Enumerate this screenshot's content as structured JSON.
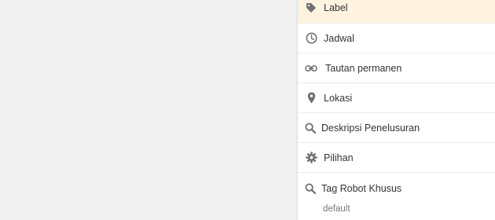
{
  "settings_panel": {
    "items": [
      {
        "label": "Label",
        "icon": "tag-icon"
      },
      {
        "label": "Jadwal",
        "icon": "clock-icon"
      },
      {
        "label": "Tautan permanen",
        "icon": "link-icon"
      },
      {
        "label": "Lokasi",
        "icon": "map-pin-icon"
      },
      {
        "label": "Deskripsi Penelusuran",
        "icon": "search-icon"
      },
      {
        "label": "Pilihan",
        "icon": "gear-icon"
      },
      {
        "label": "Tag Robot Khusus",
        "icon": "search-icon",
        "value": "default"
      }
    ]
  },
  "colors": {
    "active_background": "#fdf3df",
    "icon": "#707070",
    "text": "#333333",
    "page_background": "#f1f1f1"
  }
}
